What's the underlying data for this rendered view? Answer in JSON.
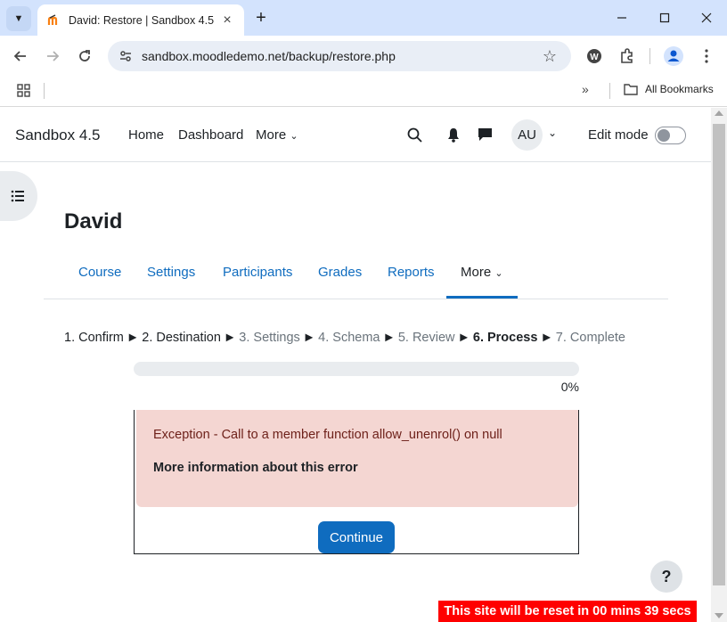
{
  "browser": {
    "tab_title": "David: Restore | Sandbox 4.5",
    "url": "sandbox.moodledemo.net/backup/restore.php",
    "all_bookmarks": "All Bookmarks"
  },
  "navbar": {
    "brand": "Sandbox 4.5",
    "links": [
      "Home",
      "Dashboard",
      "More"
    ],
    "avatar_initials": "AU",
    "edit_mode_label": "Edit mode"
  },
  "course": {
    "title": "David",
    "tabs": [
      "Course",
      "Settings",
      "Participants",
      "Grades",
      "Reports",
      "More"
    ]
  },
  "restore": {
    "steps": [
      "1. Confirm",
      "2. Destination",
      "3. Settings",
      "4. Schema",
      "5. Review",
      "6. Process",
      "7. Complete"
    ],
    "step_separator": "►",
    "progress_value": 0,
    "progress_text": "0%",
    "error_message": "Exception - Call to a member function allow_unenrol() on null",
    "more_info": "More information about this error",
    "continue_label": "Continue"
  },
  "help_label": "?",
  "reset_banner": "This site will be reset in 00 mins 39 secs",
  "colors": {
    "primary": "#0f6cbf",
    "alert_bg": "#f4d6d2",
    "alert_text": "#6e211a",
    "banner": "#ff0000",
    "chrome_titlebar": "#d3e3fd"
  }
}
